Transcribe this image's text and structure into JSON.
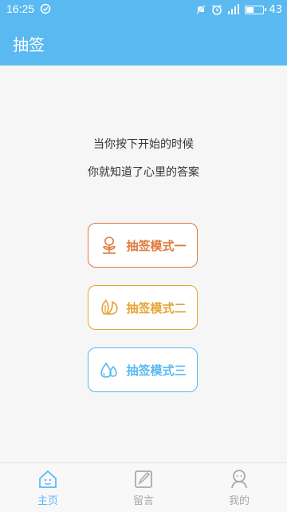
{
  "status": {
    "time": "16:25",
    "battery": "43",
    "battery_fraction": 0.43
  },
  "appbar": {
    "title": "抽签"
  },
  "intro": {
    "line1": "当你按下开始的时候",
    "line2": "你就知道了心里的答案"
  },
  "modes": [
    {
      "label": "抽签模式一",
      "icon": "flower-icon",
      "color": "#e07a3c"
    },
    {
      "label": "抽签模式二",
      "icon": "leaf-icon",
      "color": "#e6a535"
    },
    {
      "label": "抽签模式三",
      "icon": "water-drops-icon",
      "color": "#5ab9f1"
    }
  ],
  "tabs": [
    {
      "label": "主页",
      "icon": "home-icon",
      "active": true
    },
    {
      "label": "留言",
      "icon": "note-icon",
      "active": false
    },
    {
      "label": "我的",
      "icon": "profile-icon",
      "active": false
    }
  ],
  "colors": {
    "primary": "#5ab9f1",
    "inactive": "#a8a8a8"
  }
}
